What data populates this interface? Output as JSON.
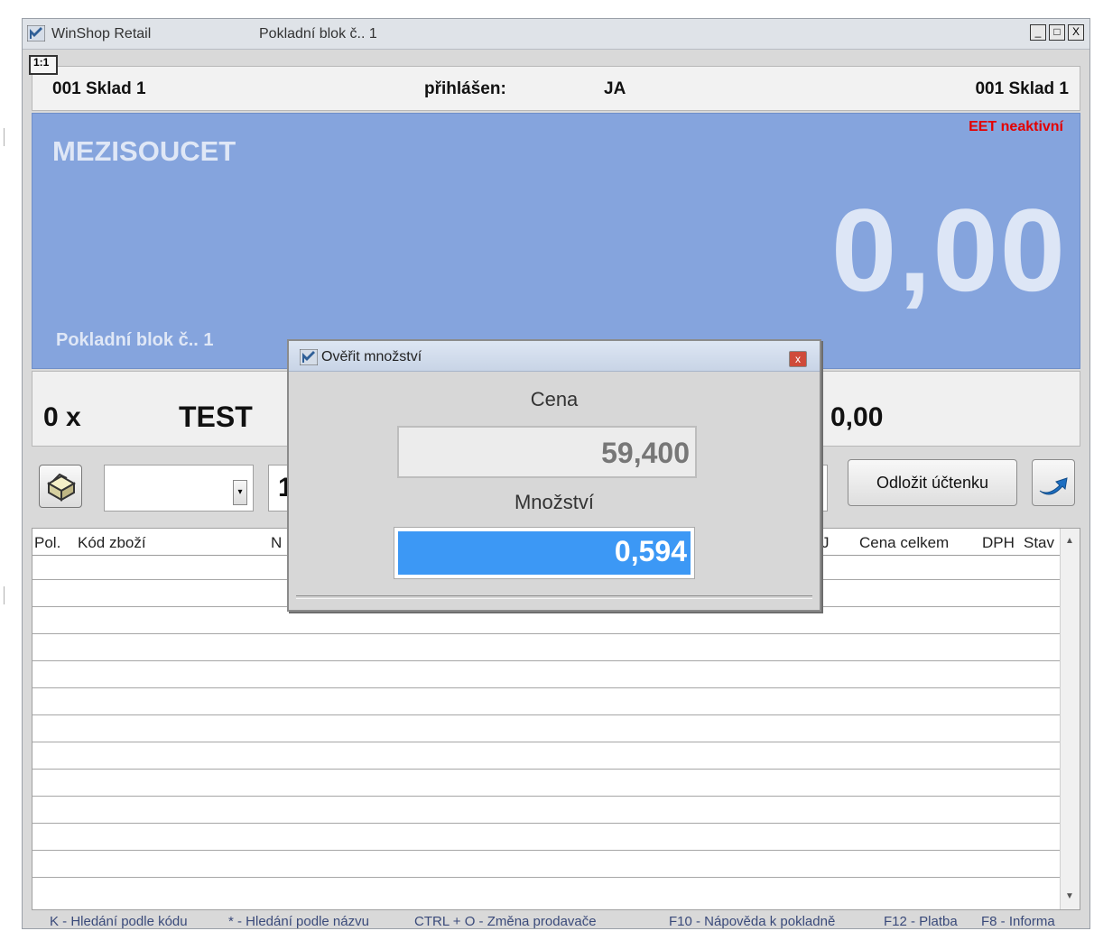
{
  "window": {
    "app_title": "WinShop Retail",
    "doc_title": "Pokladní blok č.. 1",
    "min_icon": "_",
    "max_icon": "□",
    "close_icon": "X",
    "ratio": "1:1"
  },
  "info": {
    "warehouse_left": "001 Sklad 1",
    "logged_label": "přihlášen:",
    "user": "JA",
    "warehouse_right": "001 Sklad 1"
  },
  "summary": {
    "eet_status": "EET neaktivní",
    "subtotal_label": "MEZISOUCET",
    "subtotal_value": "0,00",
    "block_label": "Pokladní blok č.. 1"
  },
  "item": {
    "quantity": "0 x",
    "name": "TEST",
    "price": "0,00"
  },
  "toolbar": {
    "combo_value": "",
    "qty_value": "1",
    "defer_label": "Odložit účtenku"
  },
  "grid": {
    "columns": [
      "Pol.",
      "Kód zboží",
      "N",
      "J",
      "Cena celkem",
      "DPH",
      "Stav"
    ]
  },
  "statusbar": {
    "items": [
      "K - Hledání podle kódu",
      "* - Hledání podle názvu",
      "CTRL + O - Změna prodavače",
      "F10 - Nápověda k pokladně",
      "F12 - Platba",
      "F8 - Informa"
    ]
  },
  "dialog": {
    "title": "Ověřit množství",
    "price_label": "Cena",
    "price_value": "59,400",
    "qty_label": "Množství",
    "qty_value": "0,594",
    "close_icon": "x"
  },
  "colors": {
    "summary_bg": "#85a4dd",
    "eet_red": "#e30000",
    "selection_blue": "#3c98f5"
  },
  "icons": [
    "app-logo-icon",
    "cash-drawer-icon",
    "dropdown-arrow-icon",
    "return-arrow-icon",
    "close-icon"
  ]
}
